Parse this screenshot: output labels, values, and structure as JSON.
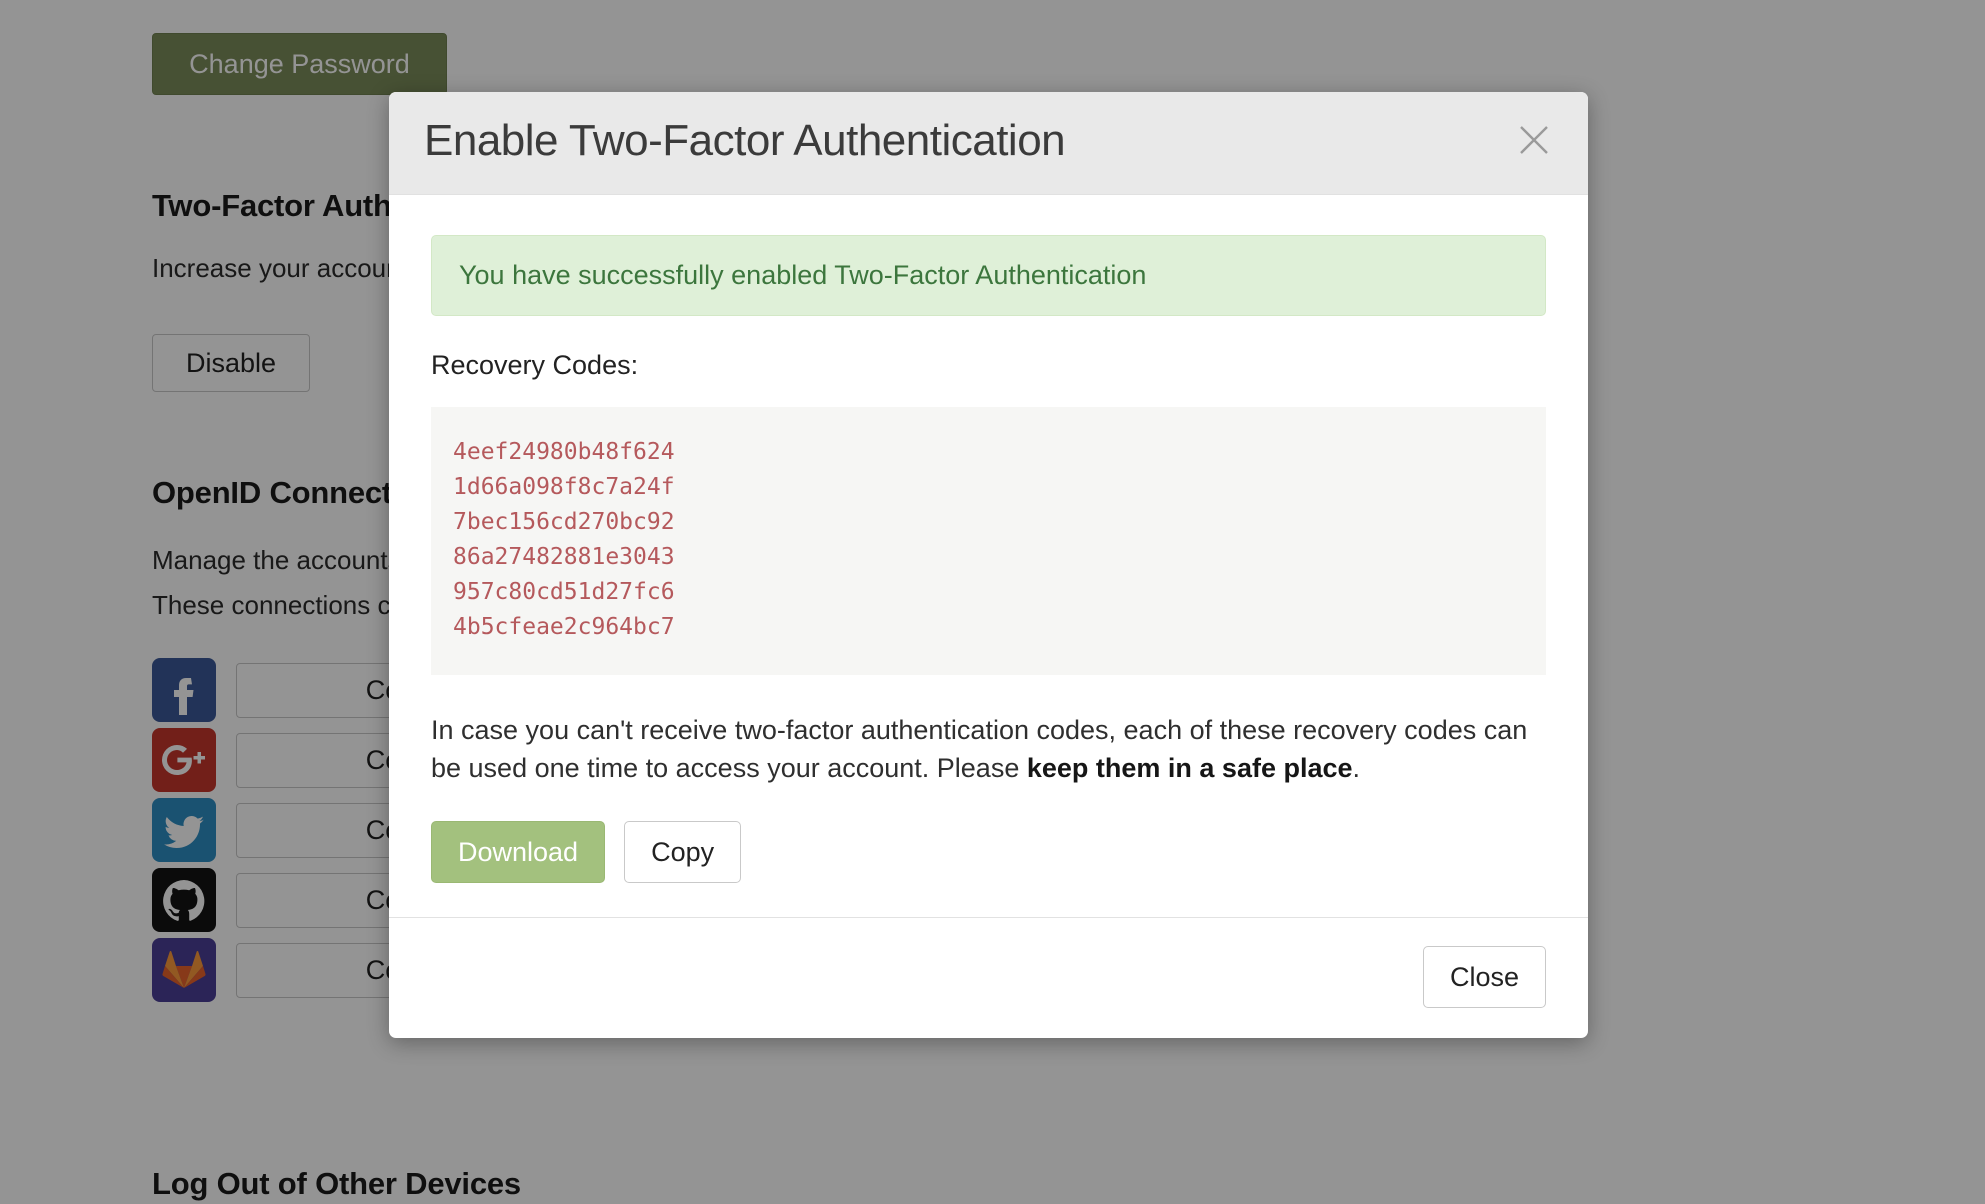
{
  "background": {
    "change_password_label": "Change Password",
    "two_factor": {
      "heading": "Two-Factor Authentication",
      "description": "Increase your account's security",
      "disable_label": "Disable"
    },
    "openid": {
      "heading": "OpenID Connect",
      "description_line_1": "Manage the accounts connected to this profile.",
      "description_line_2": "These connections can be used to sign in."
    },
    "providers": [
      {
        "name": "Facebook",
        "icon": "facebook-icon",
        "connect_label": "Connect",
        "color": "#3b5998"
      },
      {
        "name": "Google+",
        "icon": "google-plus-icon",
        "connect_label": "Connect",
        "color": "#c4362c"
      },
      {
        "name": "Twitter",
        "icon": "twitter-icon",
        "connect_label": "Connect",
        "color": "#2d8dc3"
      },
      {
        "name": "GitHub",
        "icon": "github-icon",
        "connect_label": "Connect",
        "color": "#141414"
      },
      {
        "name": "GitLab",
        "icon": "gitlab-icon",
        "connect_label": "Connect",
        "color": "#4b3f96"
      }
    ],
    "logout_heading": "Log Out of Other Devices"
  },
  "modal": {
    "title": "Enable Two-Factor Authentication",
    "close_icon": "close-icon",
    "success_message": "You have successfully enabled Two-Factor Authentication",
    "recovery_codes_label": "Recovery Codes:",
    "recovery_codes": [
      "4eef24980b48f624",
      "1d66a098f8c7a24f",
      "7bec156cd270bc92",
      "86a27482881e3043",
      "957c80cd51d27fc6",
      "4b5cfeae2c964bc7"
    ],
    "note": {
      "part_1": "In case you can't receive two-factor authentication codes, each of these recovery codes can be used one time to access your account. Please ",
      "bold": "keep them in a safe place",
      "part_2": "."
    },
    "download_label": "Download",
    "copy_label": "Copy",
    "close_label": "Close"
  },
  "colors": {
    "success_bg": "#dff0d8",
    "success_text": "#3c763d",
    "code_text": "#b5595c",
    "download_btn": "#a3c17e",
    "change_password_btn": "#7b8c5a",
    "modal_header_bg": "#e9e9e9"
  }
}
